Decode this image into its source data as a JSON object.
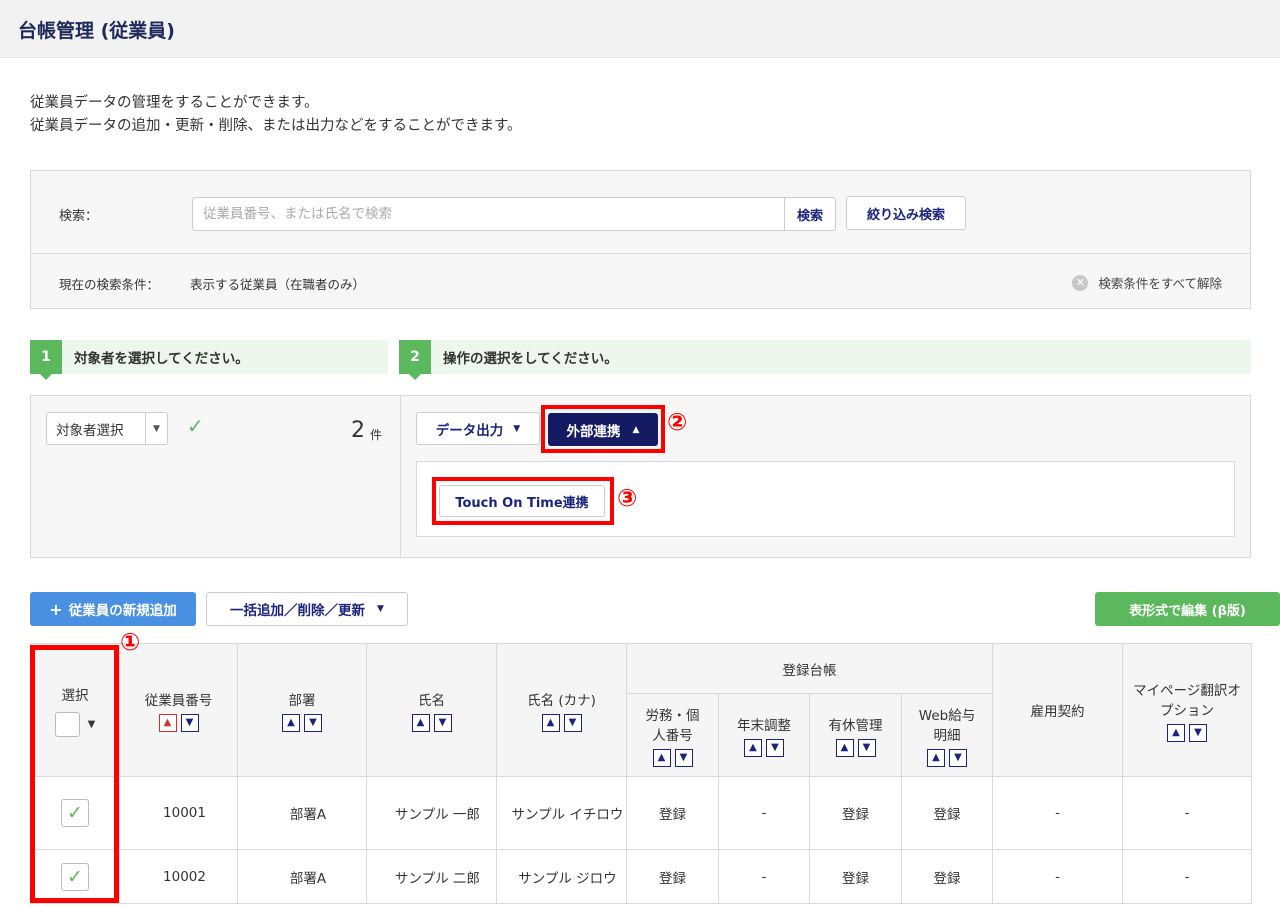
{
  "header": {
    "title": "台帳管理 (従業員)"
  },
  "description": {
    "line1": "従業員データの管理をすることができます。",
    "line2": "従業員データの追加・更新・削除、または出力などをすることができます。"
  },
  "search": {
    "label": "検索：",
    "placeholder": "従業員番号、または氏名で検索",
    "search_button": "検索",
    "filter_button": "絞り込み検索",
    "condition_label": "現在の検索条件：",
    "condition_value": "表示する従業員（在職者のみ）",
    "clear_all": "検索条件をすべて解除"
  },
  "steps": [
    {
      "num": "1",
      "text": "対象者を選択してください。"
    },
    {
      "num": "2",
      "text": "操作の選択をしてください。"
    }
  ],
  "selection": {
    "select_label": "対象者選択",
    "count": "2",
    "count_unit": "件"
  },
  "actions": {
    "data_output": "データ出力",
    "external_link": "外部連携",
    "touch_on_time": "Touch On Time連携"
  },
  "annotations": {
    "n1": "①",
    "n2": "②",
    "n3": "③"
  },
  "toolbar": {
    "add_employee": "従業員の新規追加",
    "bulk": "一括追加／削除／更新",
    "grid_edit": "表形式で編集 (β版)"
  },
  "table": {
    "headers": {
      "select": "選択",
      "emp_no": "従業員番号",
      "dept": "部署",
      "name": "氏名",
      "kana": "氏名 (カナ)",
      "ledger": "登録台帳",
      "labor": "労務・個人番号",
      "year_end": "年末調整",
      "paid_leave": "有休管理",
      "web_pay": "Web給与明細",
      "contract": "雇用契約",
      "mypage": "マイページ翻訳オプション"
    },
    "rows": [
      {
        "emp_no": "10001",
        "dept": "部署A",
        "name": "サンプル 一郎",
        "kana": "サンプル イチロウ",
        "labor": "登録",
        "year_end": "-",
        "paid_leave": "登録",
        "web_pay": "登録",
        "contract": "-",
        "mypage": "-"
      },
      {
        "emp_no": "10002",
        "dept": "部署A",
        "name": "サンプル 二郎",
        "kana": "サンプル ジロウ",
        "labor": "登録",
        "year_end": "-",
        "paid_leave": "登録",
        "web_pay": "登録",
        "contract": "-",
        "mypage": "-"
      }
    ]
  },
  "colors": {
    "brand_navy": "#141b63",
    "accent_green": "#5cb85c",
    "primary_blue": "#4a90e2",
    "annotation_red": "#ff0000"
  }
}
